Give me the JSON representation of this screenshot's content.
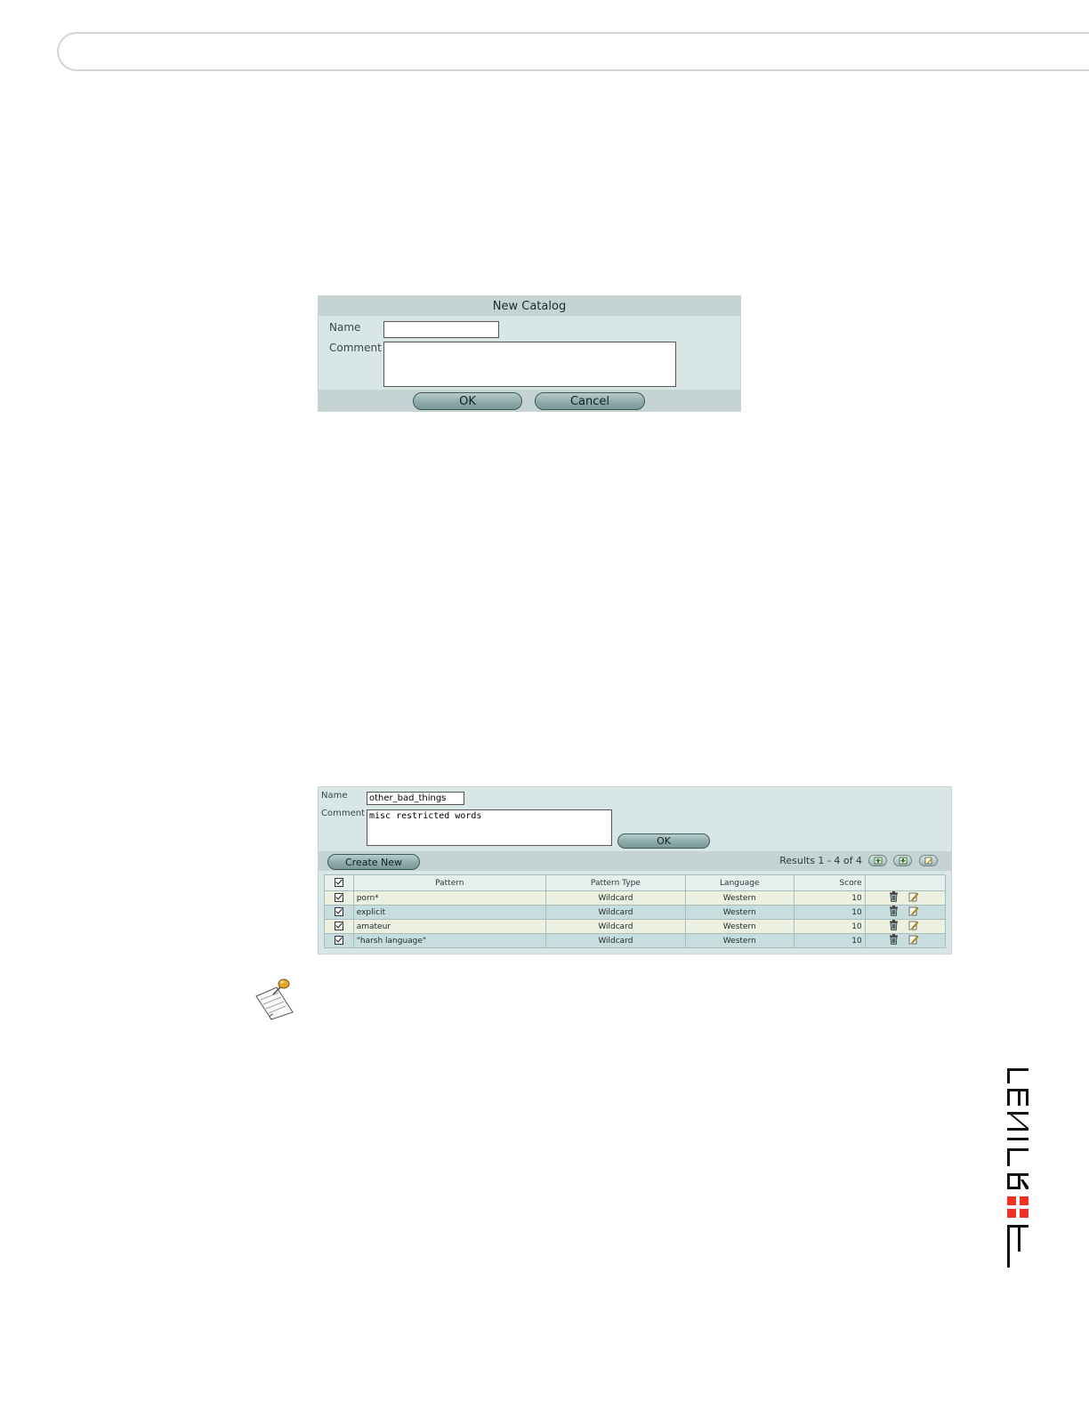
{
  "new_catalog_dialog": {
    "title": "New Catalog",
    "name_label": "Name",
    "name_value": "",
    "comment_label": "Comment",
    "comment_value": "",
    "ok_label": "OK",
    "cancel_label": "Cancel"
  },
  "catalog_panel": {
    "name_label": "Name",
    "name_value": "other_bad_things",
    "comment_label": "Comment",
    "comment_value": "misc restricted words",
    "ok_label": "OK",
    "create_new_label": "Create New",
    "results_text": "Results 1 - 4 of 4",
    "columns": [
      "Pattern",
      "Pattern Type",
      "Language",
      "Score"
    ],
    "rows": [
      {
        "pattern": "porn*",
        "type": "Wildcard",
        "language": "Western",
        "score": "10"
      },
      {
        "pattern": "explicit",
        "type": "Wildcard",
        "language": "Western",
        "score": "10"
      },
      {
        "pattern": "amateur",
        "type": "Wildcard",
        "language": "Western",
        "score": "10"
      },
      {
        "pattern": "\"harsh language\"",
        "type": "Wildcard",
        "language": "Western",
        "score": "10"
      }
    ]
  },
  "icons": {
    "nav_prev": "page-up-icon",
    "nav_next": "page-down-icon",
    "nav_edit": "edit-icon",
    "row_delete": "trash-icon",
    "row_edit": "edit-icon",
    "note": "note-icon"
  },
  "logo": {
    "text": "FORTINET",
    "accent": "#ee3124"
  }
}
